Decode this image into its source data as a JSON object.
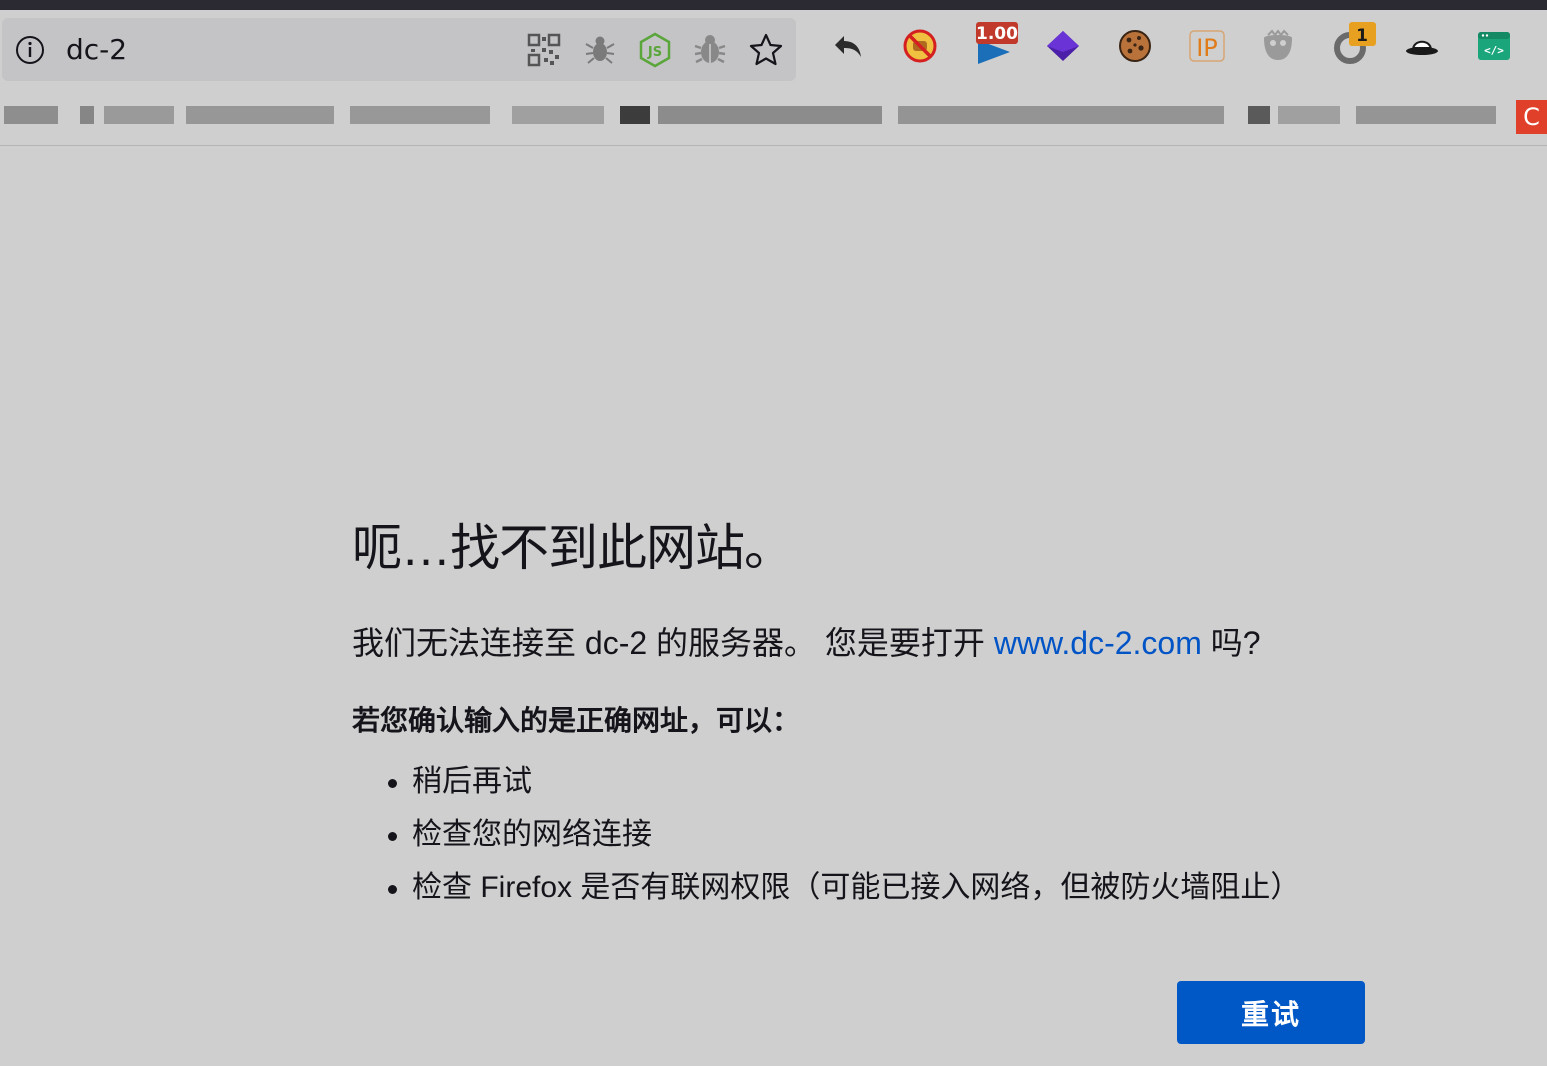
{
  "browser": {
    "url": "dc-2",
    "page_action_icons": [
      "qr-code-icon",
      "bug-robot-icon",
      "nodejs-icon",
      "bug-icon",
      "bookmark-star-icon"
    ],
    "extension_icons": [
      "undo-arrow-icon",
      "no-food-icon",
      "speed-badge-icon",
      "purple-stack-icon",
      "cookie-icon",
      "ip-icon",
      "ghost-icon",
      "refresh-badge-icon",
      "fedora-hat-icon",
      "code-window-icon"
    ],
    "extension_badges": {
      "speed": "1.00",
      "refresh": "1"
    },
    "ip_label": "IP",
    "bookmark_last_label": "C"
  },
  "error_page": {
    "title": "呃…找不到此网站。",
    "description_prefix": "我们无法连接至 dc-2 的服务器。 您是要打开 ",
    "suggested_url": "www.dc-2.com",
    "description_suffix": " 吗?",
    "subheading": "若您确认输入的是正确网址，可以：",
    "suggestions": [
      "稍后再试",
      "检查您的网络连接",
      "检查 Firefox 是否有联网权限（可能已接入网络，但被防火墙阻止）"
    ],
    "retry_label": "重试"
  },
  "colors": {
    "page_bg": "#cfcfcf",
    "url_bar_bg": "#c4c4c6",
    "link": "#0054c6",
    "button": "#0058c7",
    "title_text": "#15141a"
  }
}
